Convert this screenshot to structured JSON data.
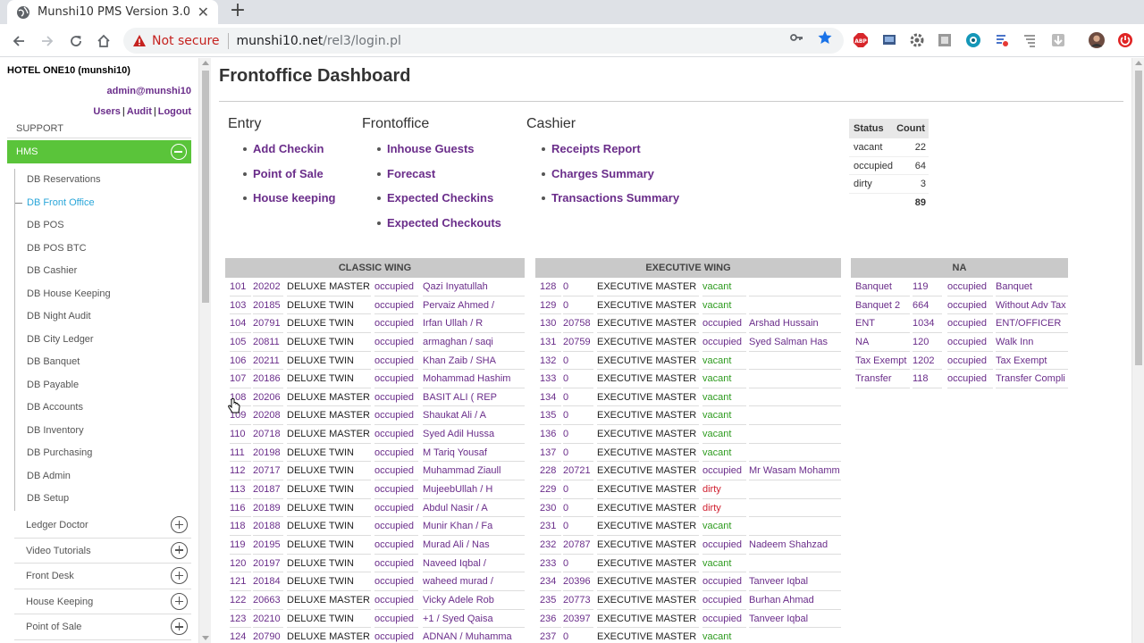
{
  "browser": {
    "tab_title": "Munshi10 PMS Version 3.0",
    "security_label": "Not secure",
    "url_host": "munshi10.net",
    "url_path": "/rel3/login.pl"
  },
  "sidebar": {
    "hotel": "HOTEL ONE10 (munshi10)",
    "user": "admin@munshi10",
    "links": [
      "Users",
      "Audit",
      "Logout"
    ],
    "support": "SUPPORT",
    "hms": "HMS",
    "items": [
      {
        "label": "DB Reservations"
      },
      {
        "label": "DB Front Office"
      },
      {
        "label": "DB POS"
      },
      {
        "label": "DB POS BTC"
      },
      {
        "label": "DB Cashier"
      },
      {
        "label": "DB House Keeping"
      },
      {
        "label": "DB Night Audit"
      },
      {
        "label": "DB City Ledger"
      },
      {
        "label": "DB Banquet"
      },
      {
        "label": "DB Payable"
      },
      {
        "label": "DB Accounts"
      },
      {
        "label": "DB Inventory"
      },
      {
        "label": "DB Purchasing"
      },
      {
        "label": "DB Admin"
      },
      {
        "label": "DB Setup"
      }
    ],
    "sections": [
      {
        "label": "Ledger Doctor"
      },
      {
        "label": "Video Tutorials"
      },
      {
        "label": "Front Desk"
      },
      {
        "label": "House Keeping"
      },
      {
        "label": "Point of Sale"
      }
    ]
  },
  "main": {
    "title": "Frontoffice Dashboard",
    "columns": [
      {
        "heading": "Entry",
        "links": [
          "Add Checkin",
          "Point of Sale",
          "House keeping"
        ]
      },
      {
        "heading": "Frontoffice",
        "links": [
          "Inhouse Guests",
          "Forecast",
          "Expected Checkins",
          "Expected Checkouts"
        ]
      },
      {
        "heading": "Cashier",
        "links": [
          "Receipts Report",
          "Charges Summary",
          "Transactions Summary"
        ]
      }
    ],
    "status_table": {
      "headers": [
        "Status",
        "Count"
      ],
      "rows": [
        {
          "status": "vacant",
          "count": "22"
        },
        {
          "status": "occupied",
          "count": "64"
        },
        {
          "status": "dirty",
          "count": "3"
        }
      ],
      "total": "89"
    }
  },
  "wings": {
    "classic": {
      "title": "CLASSIC WING",
      "rows": [
        [
          "101",
          "20202",
          "DELUXE MASTER",
          "occupied",
          "Qazi Inyatullah"
        ],
        [
          "103",
          "20185",
          "DELUXE TWIN",
          "occupied",
          "Pervaiz Ahmed /"
        ],
        [
          "104",
          "20791",
          "DELUXE TWIN",
          "occupied",
          "Irfan Ullah / R"
        ],
        [
          "105",
          "20811",
          "DELUXE TWIN",
          "occupied",
          "armaghan / saqi"
        ],
        [
          "106",
          "20211",
          "DELUXE TWIN",
          "occupied",
          "Khan Zaib / SHA"
        ],
        [
          "107",
          "20186",
          "DELUXE TWIN",
          "occupied",
          "Mohammad Hashim"
        ],
        [
          "108",
          "20206",
          "DELUXE MASTER",
          "occupied",
          "BASIT ALI ( REP"
        ],
        [
          "109",
          "20208",
          "DELUXE MASTER",
          "occupied",
          "Shaukat Ali / A"
        ],
        [
          "110",
          "20718",
          "DELUXE MASTER",
          "occupied",
          "Syed Adil Hussa"
        ],
        [
          "111",
          "20198",
          "DELUXE TWIN",
          "occupied",
          "M Tariq Yousaf"
        ],
        [
          "112",
          "20717",
          "DELUXE TWIN",
          "occupied",
          "Muhammad Ziaull"
        ],
        [
          "113",
          "20187",
          "DELUXE TWIN",
          "occupied",
          "MujeebUllah / H"
        ],
        [
          "116",
          "20189",
          "DELUXE TWIN",
          "occupied",
          "Abdul Nasir / A"
        ],
        [
          "118",
          "20188",
          "DELUXE TWIN",
          "occupied",
          "Munir Khan / Fa"
        ],
        [
          "119",
          "20195",
          "DELUXE TWIN",
          "occupied",
          "Murad Ali / Nas"
        ],
        [
          "120",
          "20197",
          "DELUXE TWIN",
          "occupied",
          "Naveed Iqbal /"
        ],
        [
          "121",
          "20184",
          "DELUXE TWIN",
          "occupied",
          "waheed murad /"
        ],
        [
          "122",
          "20663",
          "DELUXE MASTER",
          "occupied",
          "Vicky Adele Rob"
        ],
        [
          "123",
          "20210",
          "DELUXE TWIN",
          "occupied",
          "+1 / Syed Qaisa"
        ],
        [
          "124",
          "20790",
          "DELUXE MASTER",
          "occupied",
          "ADNAN / Muhamma"
        ]
      ]
    },
    "executive": {
      "title": "EXECUTIVE WING",
      "rows": [
        [
          "128",
          "0",
          "EXECUTIVE MASTER",
          "vacant",
          ""
        ],
        [
          "129",
          "0",
          "EXECUTIVE MASTER",
          "vacant",
          ""
        ],
        [
          "130",
          "20758",
          "EXECUTIVE MASTER",
          "occupied",
          "Arshad Hussain"
        ],
        [
          "131",
          "20759",
          "EXECUTIVE MASTER",
          "occupied",
          "Syed Salman Has"
        ],
        [
          "132",
          "0",
          "EXECUTIVE MASTER",
          "vacant",
          ""
        ],
        [
          "133",
          "0",
          "EXECUTIVE MASTER",
          "vacant",
          ""
        ],
        [
          "134",
          "0",
          "EXECUTIVE MASTER",
          "vacant",
          ""
        ],
        [
          "135",
          "0",
          "EXECUTIVE MASTER",
          "vacant",
          ""
        ],
        [
          "136",
          "0",
          "EXECUTIVE MASTER",
          "vacant",
          ""
        ],
        [
          "137",
          "0",
          "EXECUTIVE MASTER",
          "vacant",
          ""
        ],
        [
          "228",
          "20721",
          "EXECUTIVE MASTER",
          "occupied",
          "Mr Wasam Mohamm"
        ],
        [
          "229",
          "0",
          "EXECUTIVE MASTER",
          "dirty",
          ""
        ],
        [
          "230",
          "0",
          "EXECUTIVE MASTER",
          "dirty",
          ""
        ],
        [
          "231",
          "0",
          "EXECUTIVE MASTER",
          "vacant",
          ""
        ],
        [
          "232",
          "20787",
          "EXECUTIVE MASTER",
          "occupied",
          "Nadeem Shahzad"
        ],
        [
          "233",
          "0",
          "EXECUTIVE MASTER",
          "vacant",
          ""
        ],
        [
          "234",
          "20396",
          "EXECUTIVE MASTER",
          "occupied",
          "Tanveer Iqbal"
        ],
        [
          "235",
          "20773",
          "EXECUTIVE MASTER",
          "occupied",
          "Burhan Ahmad"
        ],
        [
          "236",
          "20397",
          "EXECUTIVE MASTER",
          "occupied",
          "Tanveer Iqbal"
        ],
        [
          "237",
          "0",
          "EXECUTIVE MASTER",
          "vacant",
          ""
        ]
      ]
    },
    "na": {
      "title": "NA",
      "rows": [
        [
          "Banquet",
          "119",
          "occupied",
          "Banquet"
        ],
        [
          "Banquet 2",
          "664",
          "occupied",
          "Without Adv Tax"
        ],
        [
          "ENT",
          "1034",
          "occupied",
          "ENT/OFFICER"
        ],
        [
          "NA",
          "120",
          "occupied",
          "Walk Inn"
        ],
        [
          "Tax Exempt",
          "1202",
          "occupied",
          "Tax Exempt"
        ],
        [
          "Transfer",
          "118",
          "occupied",
          "Transfer Compli"
        ]
      ]
    }
  },
  "colors": {
    "hms_green": "#5ac43a",
    "link_purple": "#6a2d8a",
    "vacant_green": "#2e9b1f",
    "dirty_red": "#d02030",
    "active_blue": "#2aa6d9"
  }
}
